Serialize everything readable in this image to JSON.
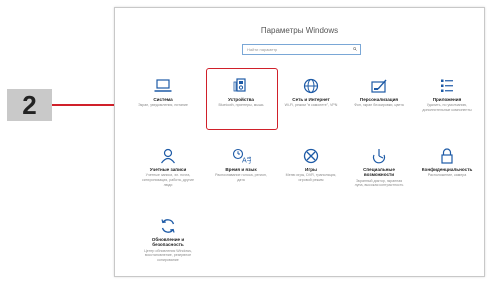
{
  "callout": {
    "number": "2",
    "line_color": "#d0202a"
  },
  "window": {
    "title": "Параметры Windows"
  },
  "search": {
    "placeholder": "Найти параметр"
  },
  "accent": "#1d5aa6",
  "items": [
    {
      "title": "Система",
      "subtitle": "Экран, уведомления, питание",
      "icon": "laptop-icon"
    },
    {
      "title": "Устройства",
      "subtitle": "Bluetooth, принтеры, мышь",
      "icon": "devices-icon"
    },
    {
      "title": "Сеть и Интернет",
      "subtitle": "Wi-Fi, режим \"в самолете\", VPN",
      "icon": "globe-icon"
    },
    {
      "title": "Персонализация",
      "subtitle": "Фон, экран блокировки, цвета",
      "icon": "personalization-icon"
    },
    {
      "title": "Приложения",
      "subtitle": "Удалить, по умолчанию, дополнительные компоненты",
      "icon": "apps-list-icon"
    },
    {
      "title": "Учетные записи",
      "subtitle": "Учетные записи, эл. почта, синхронизация, работа, другие люди",
      "icon": "person-icon"
    },
    {
      "title": "Время и язык",
      "subtitle": "Распознавание голоса, регион, дата",
      "icon": "time-language-icon"
    },
    {
      "title": "Игры",
      "subtitle": "Меню игры, DVR, трансляция, игровой режим",
      "icon": "xbox-icon"
    },
    {
      "title": "Специальные возможности",
      "subtitle": "Экранный диктор, экранная лупа, высокая контрастность",
      "icon": "ease-of-access-icon"
    },
    {
      "title": "Конфиденциальность",
      "subtitle": "Расположение, камера",
      "icon": "lock-icon"
    },
    {
      "title": "Обновление и безопасность",
      "subtitle": "Центр обновления Windows, восстановление, резервное копирование",
      "icon": "update-icon"
    }
  ]
}
